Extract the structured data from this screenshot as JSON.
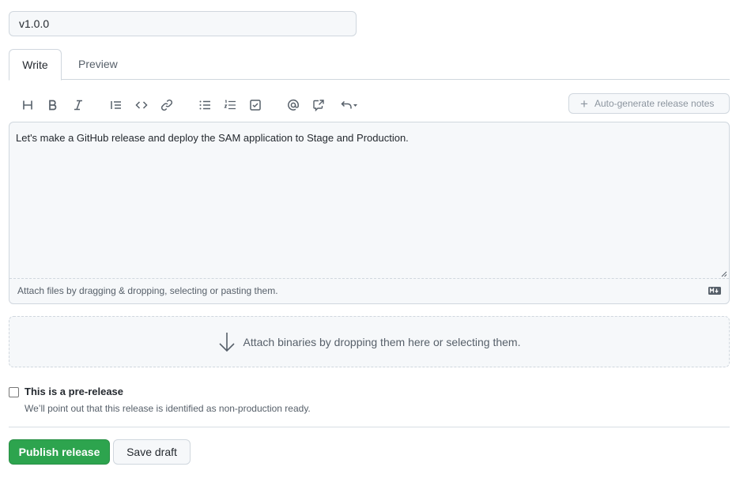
{
  "release": {
    "tag_value": "v1.0.0"
  },
  "tabs": [
    {
      "label": "Write",
      "active": true
    },
    {
      "label": "Preview",
      "active": false
    }
  ],
  "toolbar": {
    "icons": [
      "heading-icon",
      "bold-icon",
      "italic-icon",
      "quote-icon",
      "code-icon",
      "link-icon",
      "unordered-list-icon",
      "ordered-list-icon",
      "task-list-icon",
      "mention-icon",
      "reference-icon",
      "undo-icon"
    ],
    "autogen_label": "Auto-generate release notes"
  },
  "editor": {
    "body": "Let's make a GitHub release and deploy the SAM application to Stage and Production.",
    "attach_hint": "Attach files by dragging & dropping, selecting or pasting them."
  },
  "dropzone": {
    "label": "Attach binaries by dropping them here or selecting them."
  },
  "prerelease": {
    "label": "This is a pre-release",
    "note": "We’ll point out that this release is identified as non-production ready.",
    "checked": false
  },
  "actions": {
    "publish_label": "Publish release",
    "draft_label": "Save draft"
  },
  "colors": {
    "primary": "#2da44e",
    "border": "#d0d7de",
    "muted": "#57606a"
  }
}
